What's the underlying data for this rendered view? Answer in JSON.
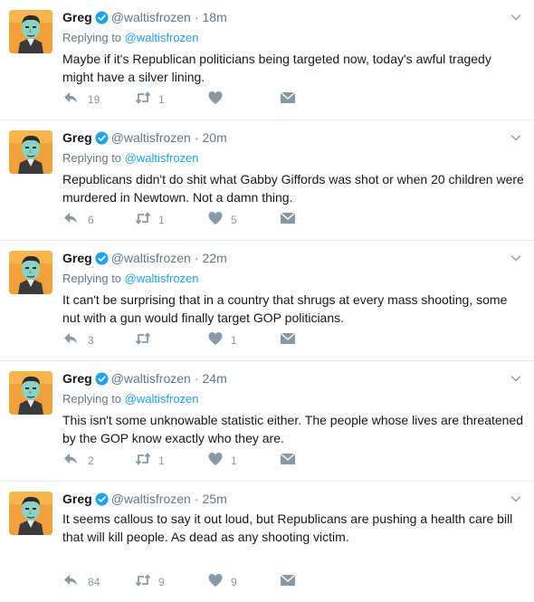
{
  "tweets": [
    {
      "name": "Greg",
      "handle": "@waltisfrozen",
      "time": "18m",
      "replying_label": "Replying to",
      "replying_handle": "@waltisfrozen",
      "text": "Maybe if it's Republican politicians being targeted now, today's awful tragedy might have a silver lining.",
      "replies": "19",
      "retweets": "1",
      "likes": ""
    },
    {
      "name": "Greg",
      "handle": "@waltisfrozen",
      "time": "20m",
      "replying_label": "Replying to",
      "replying_handle": "@waltisfrozen",
      "text": "Republicans didn't do shit what Gabby Giffords was shot or when 20 children were murdered in Newtown. Not a damn thing.",
      "replies": "6",
      "retweets": "1",
      "likes": "5"
    },
    {
      "name": "Greg",
      "handle": "@waltisfrozen",
      "time": "22m",
      "replying_label": "Replying to",
      "replying_handle": "@waltisfrozen",
      "text": "It can't be surprising that in a country that shrugs at every mass shooting, some nut with a gun would finally target GOP politicians.",
      "replies": "3",
      "retweets": "",
      "likes": "1"
    },
    {
      "name": "Greg",
      "handle": "@waltisfrozen",
      "time": "24m",
      "replying_label": "Replying to",
      "replying_handle": "@waltisfrozen",
      "text": "This isn't some unknowable statistic either. The people whose lives are threatened by the GOP know exactly who they are.",
      "replies": "2",
      "retweets": "1",
      "likes": "1"
    },
    {
      "name": "Greg",
      "handle": "@waltisfrozen",
      "time": "25m",
      "replying_label": "",
      "replying_handle": "",
      "text": "It seems callous to say it out loud, but Republicans are pushing a health care bill that will kill people. As dead as any shooting victim.",
      "replies": "84",
      "retweets": "9",
      "likes": "9"
    }
  ],
  "separator": "·",
  "icons": {
    "avatar": "pop-art-portrait-avatar",
    "verified": "verified-badge-icon",
    "caret": "chevron-down-icon",
    "reply": "reply-icon",
    "retweet": "retweet-icon",
    "like": "heart-icon",
    "dm": "envelope-icon"
  },
  "colors": {
    "link": "#1da1f2",
    "verified": "#1da1f2",
    "muted": "#657786",
    "icon": "#8899a6",
    "border": "#e6ecf0",
    "avatar_bg": "#f2a03a",
    "avatar_face": "#8ad2c3"
  }
}
